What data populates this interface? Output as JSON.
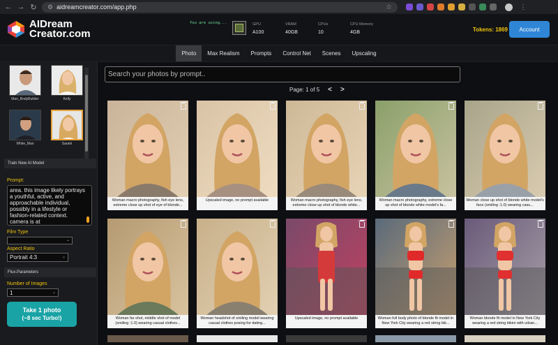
{
  "browser": {
    "url": "aidreamcreator.com/app.php"
  },
  "header": {
    "logo_line1": "AIDream",
    "logo_line2": "Creator.com",
    "using_label": "You are using...",
    "specs": [
      {
        "label": "GPU",
        "value": "A100"
      },
      {
        "label": "VRAM",
        "value": "40GB"
      },
      {
        "label": "CPUs",
        "value": "10"
      },
      {
        "label": "CPU Memory",
        "value": "4GB"
      }
    ],
    "tokens_label": "Tokens: 1869",
    "account_label": "Account"
  },
  "tabs": [
    "Photo",
    "Max Realism",
    "Prompts",
    "Control Net",
    "Scenes",
    "Upscaling"
  ],
  "sidebar": {
    "models": [
      {
        "name": "Man_BodyBuilder"
      },
      {
        "name": "Kelly"
      },
      {
        "name": "White_Man"
      },
      {
        "name": "Sarahi"
      }
    ],
    "train_label": "Train New AI Model",
    "prompt_label": "Prompt:",
    "prompt_text": "area. this image likely portrays a youthful, active, and approachable individual, possibly in a lifestyle or fashion-related context. camera is at",
    "film_type_label": "Film Type",
    "film_type_value": "",
    "aspect_label": "Aspect Ratio",
    "aspect_value": "Portrait 4:3",
    "flux_label": "Flux.Parameters",
    "num_images_label": "Number of Images",
    "num_images_value": "1",
    "cta_line1": "Take 1 photo",
    "cta_line2": "(~8 sec Turbo!)"
  },
  "main": {
    "search_placeholder": "Search your photos by prompt..",
    "page_label": "Page: 1 of 5",
    "prev": "<",
    "next": ">",
    "cards": [
      {
        "caption": "Woman macro photography, fish eye lens, extreme close up shot of eye of blonde..."
      },
      {
        "caption": "Upscaled image, no prompt available"
      },
      {
        "caption": "Woman macro photography, fish eye lens, extreme close up shot of blonde white..."
      },
      {
        "caption": "Woman macro photography, extreme close up shot of blonde white model's fa..."
      },
      {
        "caption": "Woman close up shot of blonde white model's face (smiling :1.0) wearing casu..."
      },
      {
        "caption": "Woman far shot, middle shot of model (smiling :1.0) wearing casual clothes..."
      },
      {
        "caption": "Woman headshot of smiling model wearing casual clothes posing for dating..."
      },
      {
        "caption": "Upscaled image, no prompt available"
      },
      {
        "caption": "Woman full body photo of blonde fit model in New York City wearing a red string bik..."
      },
      {
        "caption": "Woman blonde fit model in New York City wearing a red string bikini with urban..."
      }
    ]
  },
  "colors": {
    "accent_yellow": "#f1c40f",
    "account_blue": "#2f86d6",
    "cta_teal": "#1aa3a5"
  }
}
